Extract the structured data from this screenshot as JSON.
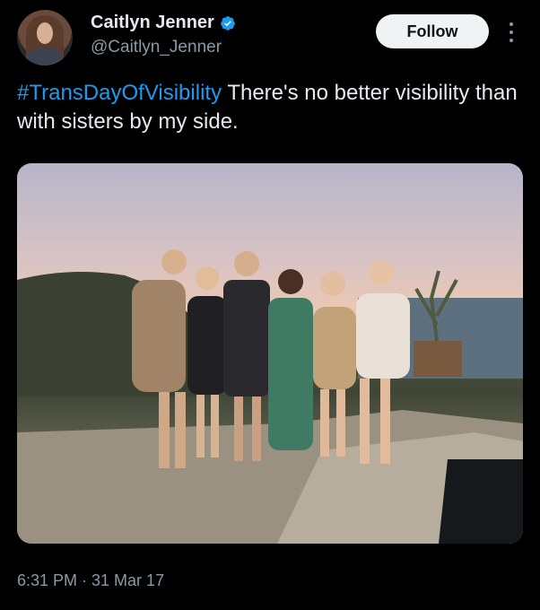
{
  "author": {
    "display_name": "Caitlyn Jenner",
    "handle": "@Caitlyn_Jenner",
    "verified_color": "#1d9bf0"
  },
  "actions": {
    "follow_label": "Follow"
  },
  "tweet": {
    "hashtag": "#TransDayOfVisibility",
    "text": " There's no better visibility than with sisters by my side."
  },
  "meta": {
    "timestamp": "6:31 PM · 31 Mar 17"
  },
  "colors": {
    "background": "#000000",
    "text": "#e7e9ea",
    "secondary": "#8b98a5",
    "link": "#1d9bf0"
  }
}
